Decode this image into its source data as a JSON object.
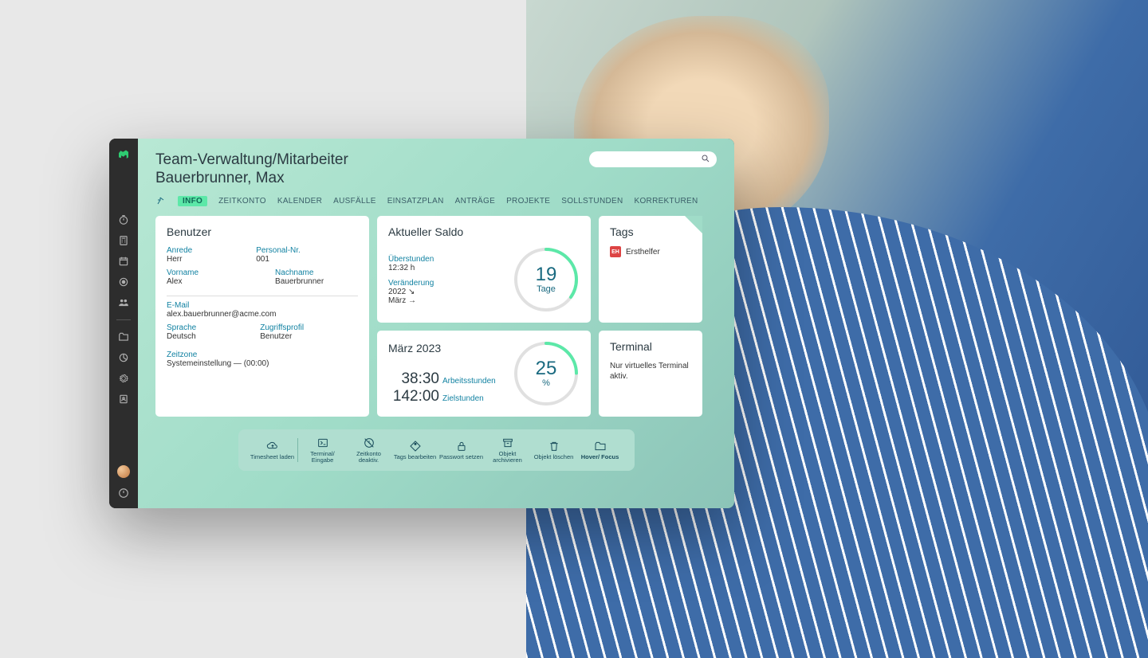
{
  "header": {
    "title": "Team-Verwaltung/Mitarbeiter",
    "subtitle": "Bauerbrunner, Max"
  },
  "search": {
    "placeholder": ""
  },
  "tabs": {
    "items": [
      "INFO",
      "ZEITKONTO",
      "KALENDER",
      "AUSFÄLLE",
      "EINSATZPLAN",
      "ANTRÄGE",
      "PROJEKTE",
      "SOLLSTUNDEN",
      "KORREKTUREN"
    ],
    "active": 0
  },
  "user": {
    "card_title": "Benutzer",
    "anrede_label": "Anrede",
    "anrede": "Herr",
    "personalnr_label": "Personal-Nr.",
    "personalnr": "001",
    "vorname_label": "Vorname",
    "vorname": "Alex",
    "nachname_label": "Nachname",
    "nachname": "Bauerbrunner",
    "email_label": "E-Mail",
    "email": "alex.bauerbrunner@acme.com",
    "sprache_label": "Sprache",
    "sprache": "Deutsch",
    "zugriff_label": "Zugriffsprofil",
    "zugriff": "Benutzer",
    "zeitzone_label": "Zeitzone",
    "zeitzone": "Systemeinstellung — (00:00)"
  },
  "saldo": {
    "card_title": "Aktueller Saldo",
    "ueber_label": "Überstunden",
    "ueber_val": "12:32 h",
    "veraend_label": "Veränderung",
    "veraend_year": "2022 ↘",
    "veraend_month": "März →",
    "ring_num": "19",
    "ring_unit": "Tage",
    "ring_pct": 35
  },
  "month": {
    "card_title": "März 2023",
    "ring_num": "25",
    "ring_unit": "%",
    "ring_pct": 25,
    "arbeit_val": "38:30",
    "arbeit_label": "Arbeitsstunden",
    "ziel_val": "142:00",
    "ziel_label": "Zielstunden"
  },
  "tags": {
    "card_title": "Tags",
    "badge": "EH",
    "label": "Ersthelfer"
  },
  "terminal": {
    "card_title": "Terminal",
    "text": "Nur virtuelles Terminal aktiv."
  },
  "actions": [
    {
      "label": "Timesheet laden",
      "icon": "cloud-sync"
    },
    {
      "label": "Terminal/ Eingabe",
      "icon": "terminal"
    },
    {
      "label": "Zeitkonto deaktiv.",
      "icon": "clock-x"
    },
    {
      "label": "Tags bearbeiten",
      "icon": "tag"
    },
    {
      "label": "Passwort setzen",
      "icon": "lock"
    },
    {
      "label": "Objekt archivieren",
      "icon": "archive"
    },
    {
      "label": "Objekt löschen",
      "icon": "trash"
    },
    {
      "label": "Hover/ Focus",
      "icon": "folder",
      "bold": true
    }
  ]
}
